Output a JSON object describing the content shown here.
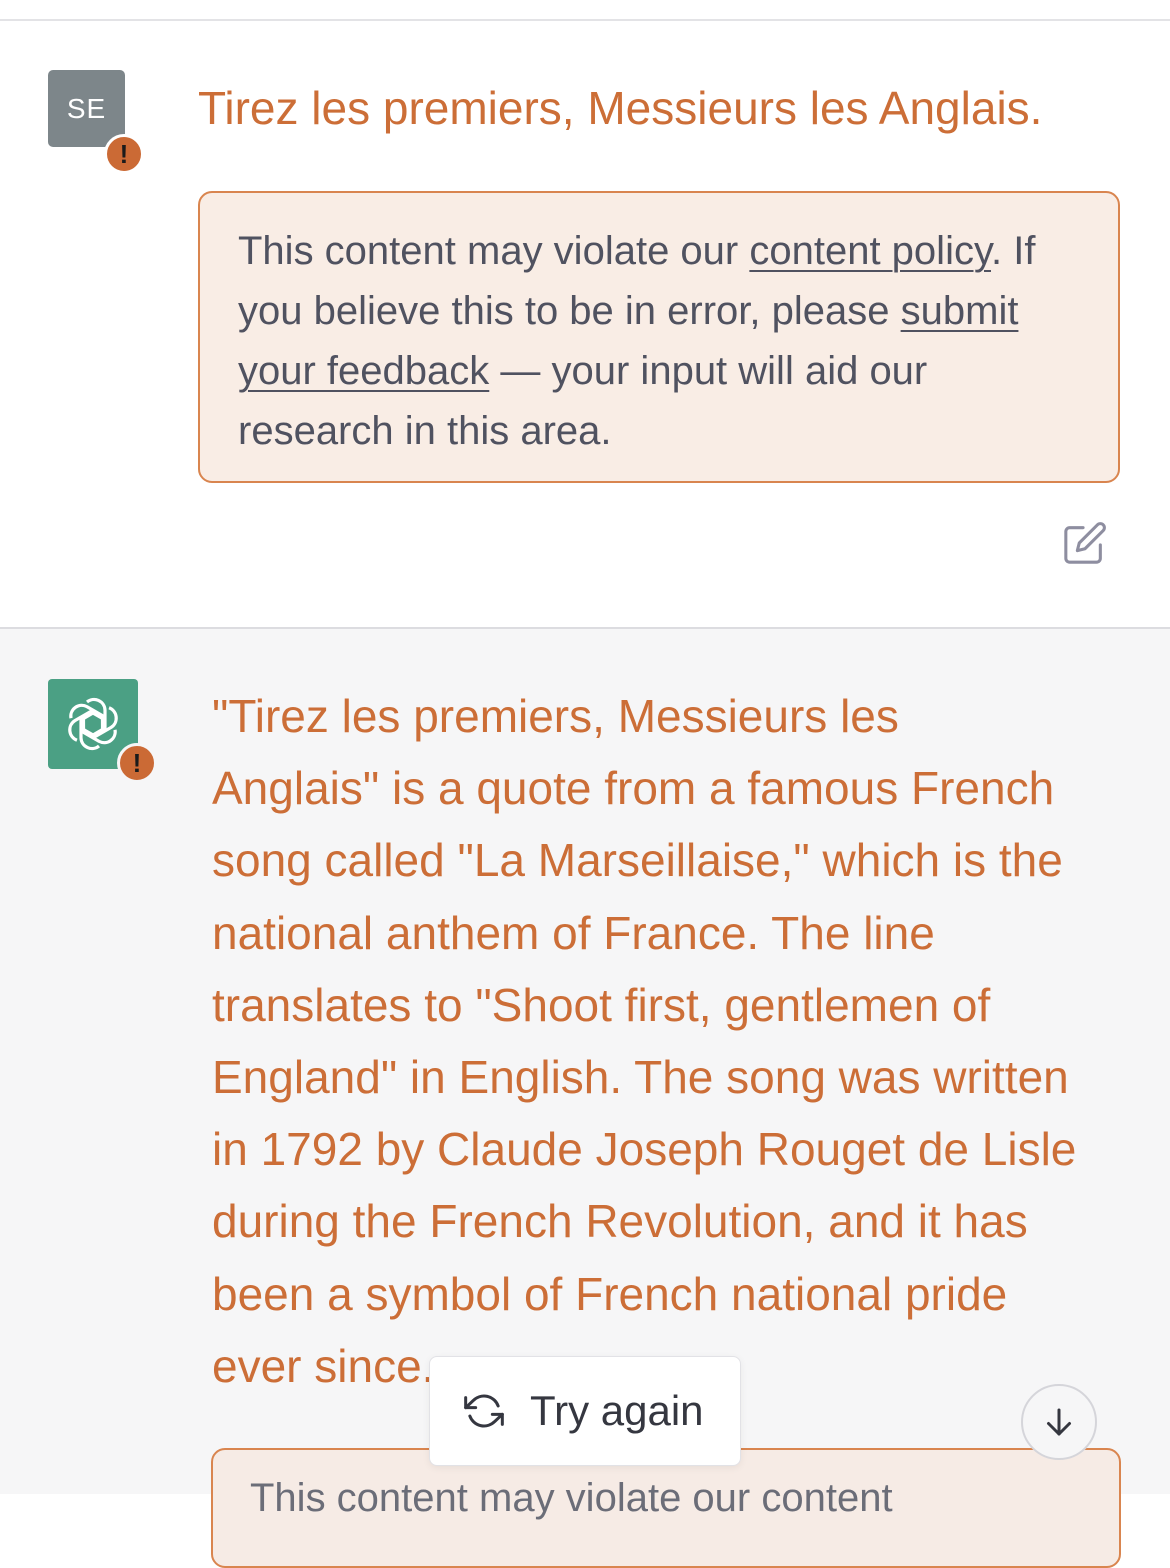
{
  "user_message": {
    "avatar_initials": "SE",
    "warning_badge": "!",
    "text": "Tirez les premiers, Messieurs les Anglais.",
    "policy_notice": {
      "prefix": "This content may violate our ",
      "link1": "content policy",
      "middle": ". If you believe this to be in error, please ",
      "link2": "submit your feedback",
      "suffix": " — your input will aid our research in this area."
    },
    "edit_icon": "edit-icon"
  },
  "assistant_message": {
    "avatar_icon": "openai-logo-icon",
    "warning_badge": "!",
    "lines": [
      "\"Tirez les premiers, Messieurs les",
      "Anglais\" is a quote from a famous French",
      "song called \"La Marseillaise,\" which is the",
      "national anthem of France. The line",
      "translates to \"Shoot first, gentlemen of",
      "England\" in English. The song was written",
      "in 1792 by Claude Joseph Rouget de Lisle",
      "during the French Revolution, and it has",
      "been a symbol of French national pride",
      "ever since."
    ],
    "partial_notice": "This content may violate our content"
  },
  "controls": {
    "try_again_label": "Try again",
    "try_again_icon": "refresh-icon",
    "scroll_down_icon": "arrow-down-icon"
  },
  "colors": {
    "accent_orange": "#cc6e37",
    "notice_bg": "#f9ede5",
    "notice_border": "#d9854f",
    "bot_green": "#4ba084",
    "user_avatar": "#7d868a"
  }
}
